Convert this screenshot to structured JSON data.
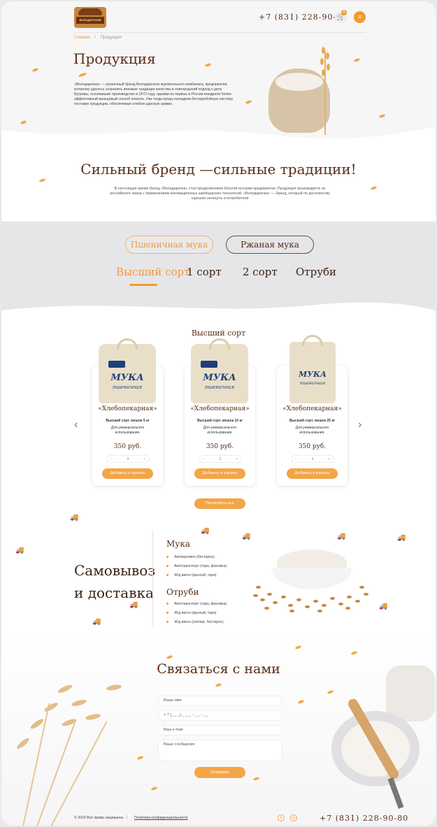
{
  "header": {
    "logo_text": "ВОЛОДАРСКИЙ",
    "phone": "+7 (831) 228-90-80",
    "cart_count": "0",
    "breadcrumbs": [
      "Главная",
      "Продукция"
    ],
    "breadcrumb_sep": "/"
  },
  "hero": {
    "title": "Продукция",
    "text": "«Володарочка» — розничный бренд Володарского мукомольного комбината, предприятия, которому удалось сохранить вековые традиции качества и новгородский подход к делу. Бугровы, основавшие производство в 1872 году, одними из первых в России внедрили более эффективный вальцовый способ помола. Уже тогда купцы наладили бесперебойную систему поставок продукции, обеспечивая хлебом царскую армию."
  },
  "brand": {
    "title": "Сильный бренд —сильные традиции!",
    "text": "В нестоящее время бренд «Володарочка» стал продолжением богатой истории предприятия. Продукция производится из российского зерна с применением инновационных швейцарских технологий. «Володарочка» — бренд, который по достоинству оценили эксперты и потребители"
  },
  "tabs": {
    "flour_types": [
      "Пшеничная мука",
      "Ржаная мука"
    ],
    "grades": [
      "Высший сорт",
      "1 сорт",
      "2 сорт",
      "Отруби"
    ],
    "active_type": 0,
    "active_grade": 0
  },
  "products": {
    "section_title": "Высший сорт",
    "bag_label": "МУКА",
    "bag_sub": "пшеничная",
    "items": [
      {
        "name": "«Хлебопекарная»",
        "spec": "Высший сорт.  мешок 5 кг",
        "desc": "Для универсального использования.",
        "price": "350 руб.",
        "qty": "1",
        "button": "Добавить в корзину"
      },
      {
        "name": "«Хлебопекарная»",
        "spec": "Высший сорт.  мешок 10 кг",
        "desc": "Для универсального использования.",
        "price": "350 руб.",
        "qty": "1",
        "button": "Добавить в корзину"
      },
      {
        "name": "«Хлебопекарная»",
        "spec": "Высший сорт.  мешок 25 кг",
        "desc": "Для универсального использования.",
        "price": "350 руб.",
        "qty": "1",
        "button": "Добавить в корзину"
      }
    ],
    "qty_minus": "-",
    "qty_plus": "+",
    "view_all": "Посмотреть все"
  },
  "delivery": {
    "title_line1": "Самовывоз",
    "title_line2": "и доставка",
    "flour_heading": "Мука",
    "flour_items": [
      "Автомуковоз (бестарно)",
      "Автотранспорт (тара, фасовка)",
      "Ж/д вагон (крытый, тара)"
    ],
    "bran_heading": "Отруби",
    "bran_items": [
      "Автотранспорт (тара, фасовка)",
      "Ж/д вагон (крытый, тара)",
      "Ж/д вагон (хоппер, бестарно)"
    ]
  },
  "contact": {
    "title": "Связаться с нами",
    "name_placeholder": "Ваше имя",
    "phone_placeholder": "+ 7 (_ _ _) _ _ _ - _ _ - _ _",
    "email_placeholder": "Ваш e-mail",
    "message_placeholder": "Ваше сообщение",
    "submit": "Отправить"
  },
  "footer": {
    "copyright": "© 2020 Все права защищены",
    "separator": "|",
    "privacy": "Политика конфиденциальности",
    "phone": "+7 (831) 228-90-80"
  },
  "colors": {
    "accent": "#f29b2e",
    "brown": "#5a2c14",
    "bag_blue": "#1e3f7a"
  }
}
